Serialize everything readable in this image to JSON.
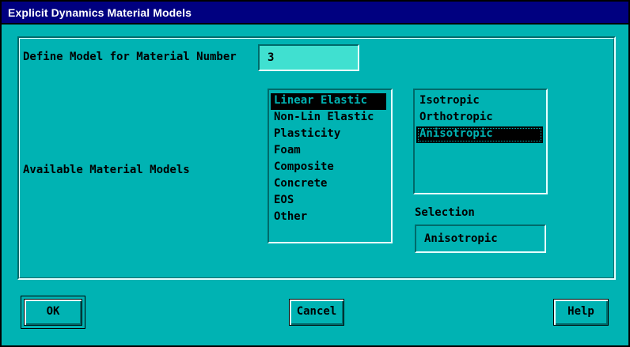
{
  "window": {
    "title": "Explicit Dynamics Material Models"
  },
  "material_number": {
    "label": "Define Model for Material Number",
    "value": "3"
  },
  "models": {
    "label": "Available Material Models",
    "items": [
      {
        "label": "Linear Elastic",
        "selected": true
      },
      {
        "label": "Non-Lin Elastic",
        "selected": false
      },
      {
        "label": "Plasticity",
        "selected": false
      },
      {
        "label": "Foam",
        "selected": false
      },
      {
        "label": "Composite",
        "selected": false
      },
      {
        "label": "Concrete",
        "selected": false
      },
      {
        "label": "EOS",
        "selected": false
      },
      {
        "label": "Other",
        "selected": false
      }
    ]
  },
  "types": {
    "items": [
      {
        "label": "Isotropic",
        "selected": false
      },
      {
        "label": "Orthotropic",
        "selected": false
      },
      {
        "label": "Anisotropic",
        "selected": true
      }
    ]
  },
  "selection": {
    "label": "Selection",
    "value": "Anisotropic"
  },
  "buttons": {
    "ok": "OK",
    "cancel": "Cancel",
    "help": "Help"
  },
  "colors": {
    "title_bar": "#000080",
    "dialog_bg": "#00b3b3",
    "input_bg": "#40e0d0",
    "selected_bg": "#000000"
  }
}
